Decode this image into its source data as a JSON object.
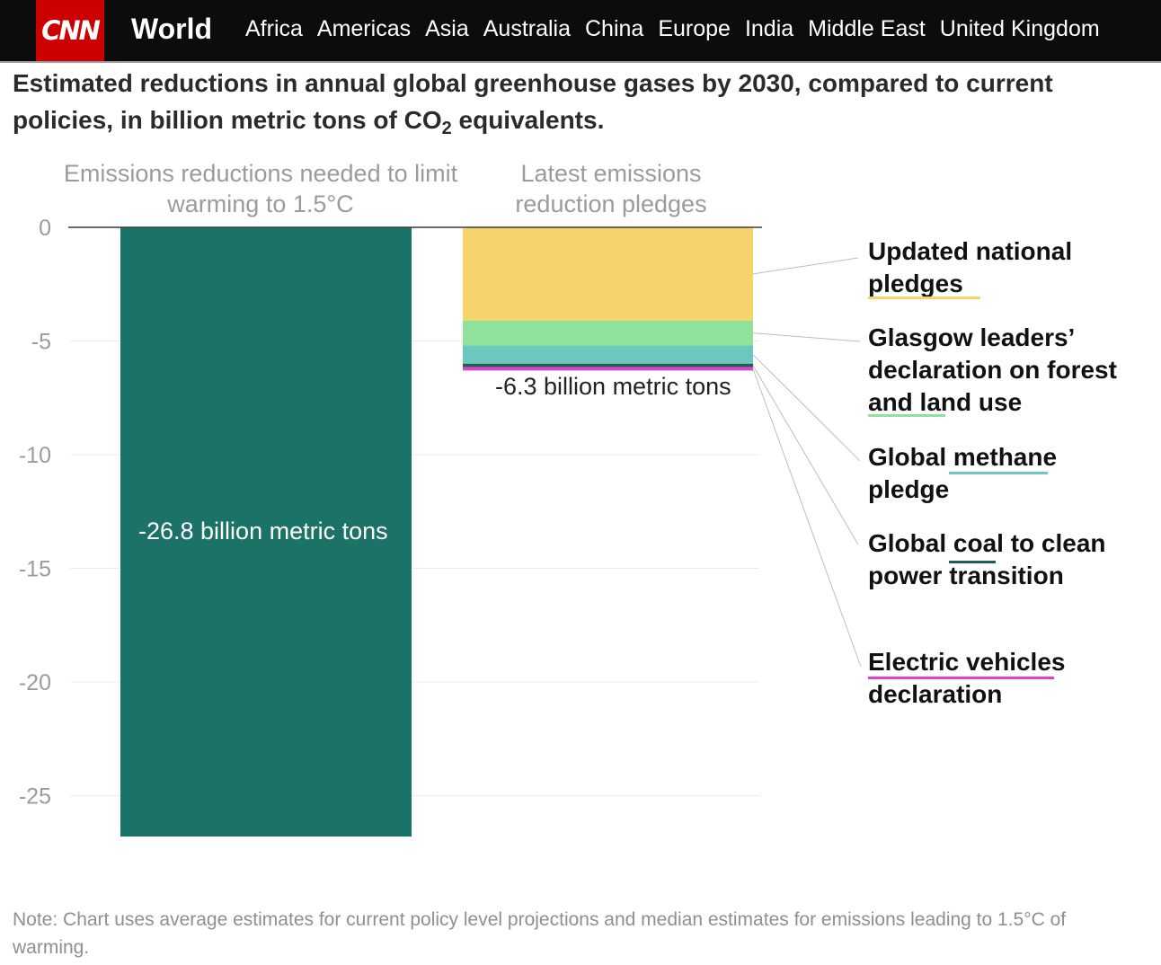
{
  "header": {
    "logo": "CNN",
    "section": "World",
    "nav": [
      "Africa",
      "Americas",
      "Asia",
      "Australia",
      "China",
      "Europe",
      "India",
      "Middle East",
      "United Kingdom"
    ]
  },
  "colors": {
    "needed_bar": "#1b7267",
    "updated_national_pledges": "#f7d36b",
    "glasgow_forest": "#8fe19c",
    "methane": "#6cc7bd",
    "coal": "#235d55",
    "ev": "#e040d0"
  },
  "chart_data": {
    "type": "bar",
    "title_prefix": "Estimated reductions in annual global greenhouse gases by 2030, compared to current policies, in billion metric tons of CO",
    "title_sub": "2",
    "title_suffix": " equivalents.",
    "categories": [
      "Emissions reductions needed to limit warming to 1.5°C",
      "Latest emissions reduction pledges"
    ],
    "ylim": [
      -27,
      0
    ],
    "yticks": [
      0,
      -5,
      -10,
      -15,
      -20,
      -25
    ],
    "grid": true,
    "needed": {
      "value": -26.8,
      "label": "-26.8 billion metric tons"
    },
    "pledges": {
      "total": -6.3,
      "label": "-6.3 billion metric tons",
      "segments": [
        {
          "name": "Updated national pledges",
          "value": -4.1
        },
        {
          "name": "Glasgow leaders’ declaration on forest and land use",
          "value": -1.1
        },
        {
          "name": "Global methane pledge",
          "value": -0.8
        },
        {
          "name": "Global coal to clean power transition",
          "value": -0.15
        },
        {
          "name": "Electric vehicles declaration",
          "value": -0.15
        }
      ]
    },
    "note": "Note: Chart uses average estimates for current policy level projections and median estimates for emissions leading to 1.5°C of warming."
  }
}
